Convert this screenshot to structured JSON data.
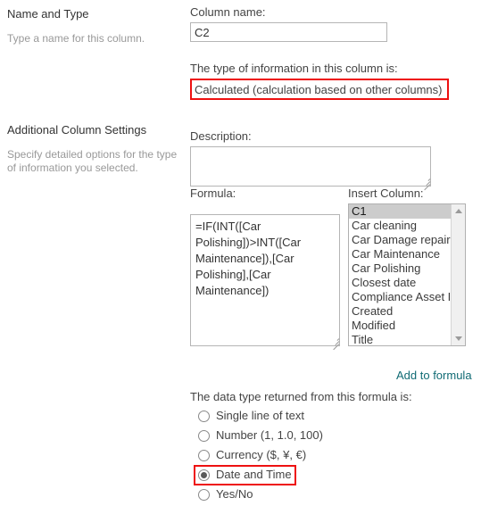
{
  "left_panel": {
    "sections": [
      {
        "heading": "Name and Type",
        "note": "Type a name for this column."
      },
      {
        "heading": "Additional Column Settings",
        "note": "Specify detailed options for the type of information you selected."
      }
    ]
  },
  "form": {
    "column_name_label": "Column name:",
    "column_name_value": "C2",
    "type_label": "The type of information in this column is:",
    "type_value": "Calculated (calculation based on other columns)",
    "description_label": "Description:",
    "description_value": "",
    "formula_label": "Formula:",
    "formula_value": "=IF(INT([Car Polishing])>INT([Car Maintenance]),[Car Polishing],[Car Maintenance])",
    "insert_column_label": "Insert Column:",
    "insert_column_items": [
      "C1",
      "Car cleaning",
      "Car Damage repair",
      "Car Maintenance",
      "Car Polishing",
      "Closest date",
      "Compliance Asset Id",
      "Created",
      "Modified",
      "Title"
    ],
    "insert_column_selected": "C1",
    "add_to_formula_label": "Add to formula",
    "data_type_label": "The data type returned from this formula is:",
    "data_type_options": [
      "Single line of text",
      "Number (1, 1.0, 100)",
      "Currency ($, ¥, €)",
      "Date and Time",
      "Yes/No"
    ],
    "data_type_selected": "Date and Time"
  },
  "highlights": {
    "color": "#ee1111",
    "targets": [
      "type_value",
      "date_and_time_option"
    ]
  }
}
